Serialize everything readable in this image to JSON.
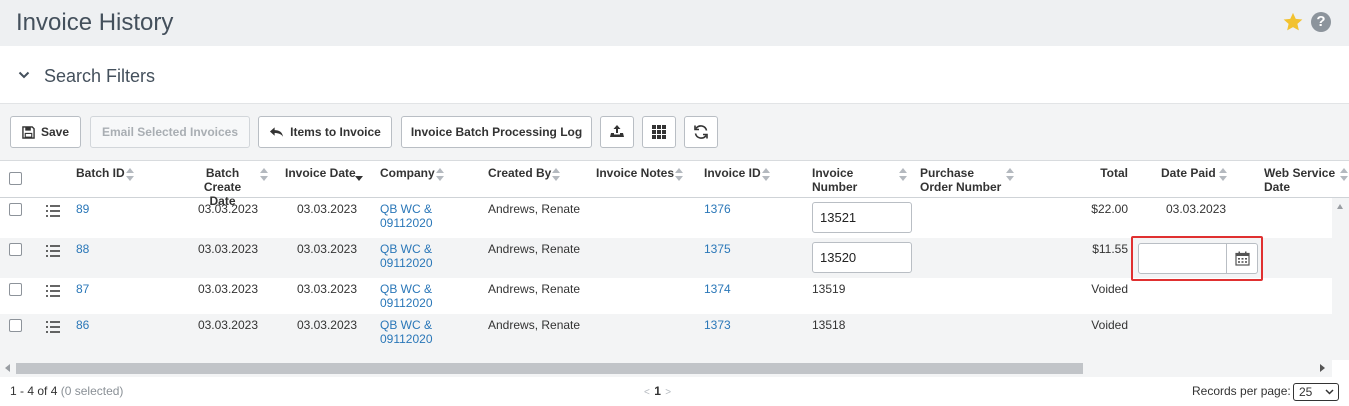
{
  "page": {
    "title": "Invoice History"
  },
  "filters": {
    "title": "Search Filters"
  },
  "toolbar": {
    "save": "Save",
    "email_selected": "Email Selected Invoices",
    "items_to_invoice": "Items to Invoice",
    "batch_log": "Invoice Batch Processing Log"
  },
  "columns": {
    "batch_id": "Batch ID",
    "batch_create_date_1": "Batch Create",
    "batch_create_date_2": "Date",
    "invoice_date": "Invoice Date",
    "company": "Company",
    "created_by": "Created By",
    "invoice_notes": "Invoice Notes",
    "invoice_id": "Invoice ID",
    "invoice_number_1": "Invoice",
    "invoice_number_2": "Number",
    "po_number_1": "Purchase",
    "po_number_2": "Order Number",
    "total": "Total",
    "date_paid": "Date Paid",
    "web_service_date_1": "Web Service",
    "web_service_date_2": "Date"
  },
  "rows": [
    {
      "batch_id": "89",
      "batch_create_date": "03.03.2023",
      "invoice_date": "03.03.2023",
      "company_1": "QB WC &",
      "company_2": "09112020",
      "created_by": "Andrews, Renate",
      "invoice_id": "1376",
      "invoice_number": "13521",
      "total": "$22.00",
      "date_paid": "03.03.2023"
    },
    {
      "batch_id": "88",
      "batch_create_date": "03.03.2023",
      "invoice_date": "03.03.2023",
      "company_1": "QB WC &",
      "company_2": "09112020",
      "created_by": "Andrews, Renate",
      "invoice_id": "1375",
      "invoice_number": "13520",
      "total": "$11.55",
      "date_paid": ""
    },
    {
      "batch_id": "87",
      "batch_create_date": "03.03.2023",
      "invoice_date": "03.03.2023",
      "company_1": "QB WC &",
      "company_2": "09112020",
      "created_by": "Andrews, Renate",
      "invoice_id": "1374",
      "invoice_number": "13519",
      "total": "Voided",
      "date_paid": ""
    },
    {
      "batch_id": "86",
      "batch_create_date": "03.03.2023",
      "invoice_date": "03.03.2023",
      "company_1": "QB WC &",
      "company_2": "09112020",
      "created_by": "Andrews, Renate",
      "invoice_id": "1373",
      "invoice_number": "13518",
      "total": "Voided",
      "date_paid": ""
    }
  ],
  "footer": {
    "range": "1 - 4 of 4",
    "selected": "(0 selected)",
    "prev": "<",
    "page": "1",
    "next": ">",
    "records_label": "Records per page:",
    "records_value": "25"
  },
  "icons": {
    "star": "star-icon",
    "help": "help-icon",
    "collapse": "chevron-down-icon",
    "save": "floppy-disk-icon",
    "back": "arrow-left-icon",
    "export": "export-icon",
    "columns": "grid-icon",
    "refresh": "refresh-icon",
    "row_menu": "list-menu-icon",
    "calendar": "calendar-icon"
  },
  "colors": {
    "link": "#2a77b8",
    "star": "#f2c230",
    "highlight": "#e03030"
  }
}
